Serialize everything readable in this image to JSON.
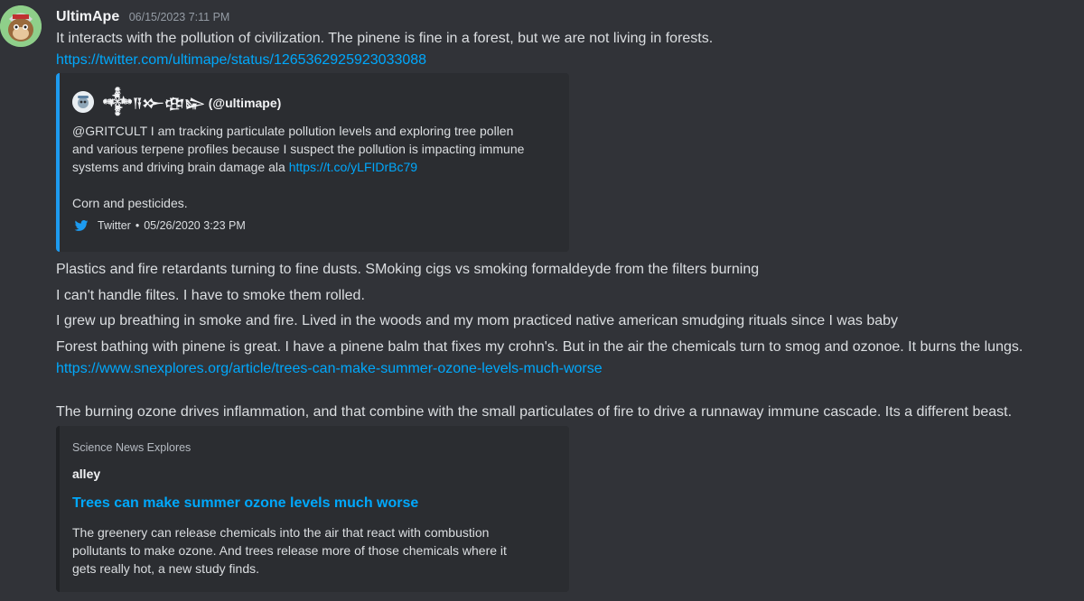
{
  "message": {
    "username": "UltimApe",
    "timestamp": "06/15/2023 7:11 PM",
    "avatar_icon": "ape-avatar-icon",
    "lines": [
      "It interacts with the pollution of civilization. The pinene is fine in a forest, but we are not living in forests.",
      "https://twitter.com/ultimape/status/1265362925923033088",
      "Plastics and fire retardants turning to fine dusts. SMoking cigs vs smoking formaldeyde from the filters burning",
      "I can't handle filtes. I have to smoke them rolled.",
      "I grew up breathing in smoke and fire. Lived in the woods and my mom practiced native american smudging rituals since I was baby",
      "Forest bathing with pinene is great. I have a pinene balm that fixes my crohn's. But in the air the chemicals turn to smog and ozonoe. It burns the lungs.",
      "https://www.snexplores.org/article/trees-can-make-summer-ozone-levels-much-worse",
      "The burning ozone drives inflammation, and that combine with the small particulates of fire to drive a runnaway immune cascade. Its a different beast."
    ]
  },
  "twitter_embed": {
    "author": "𒀱𒀀𒁍𒂦𒇽 (@ultimape)",
    "description_lines": [
      "@GRITCULT I am tracking particulate pollution levels and exploring tree pollen",
      "and various terpene profiles because I suspect the pollution is impacting immune",
      "systems and driving brain damage ala "
    ],
    "description_link": "https://t.co/yLFIDrBc79",
    "description_tail": "Corn and pesticides.",
    "footer_source": "Twitter",
    "footer_separator": "•",
    "footer_date": "05/26/2020 3:23 PM",
    "accent_color": "#1d9bf0"
  },
  "article_embed": {
    "provider": "Science News Explores",
    "author": "alley",
    "title": "Trees can make summer ozone levels much worse",
    "description_lines": [
      "The greenery can release chemicals into the air that react with combustion",
      "pollutants to make ozone. And trees release more of those chemicals where it",
      "gets really hot, a new study finds."
    ]
  },
  "colors": {
    "background": "#313338",
    "embed_background": "#2b2d31",
    "link": "#00a8fc"
  }
}
